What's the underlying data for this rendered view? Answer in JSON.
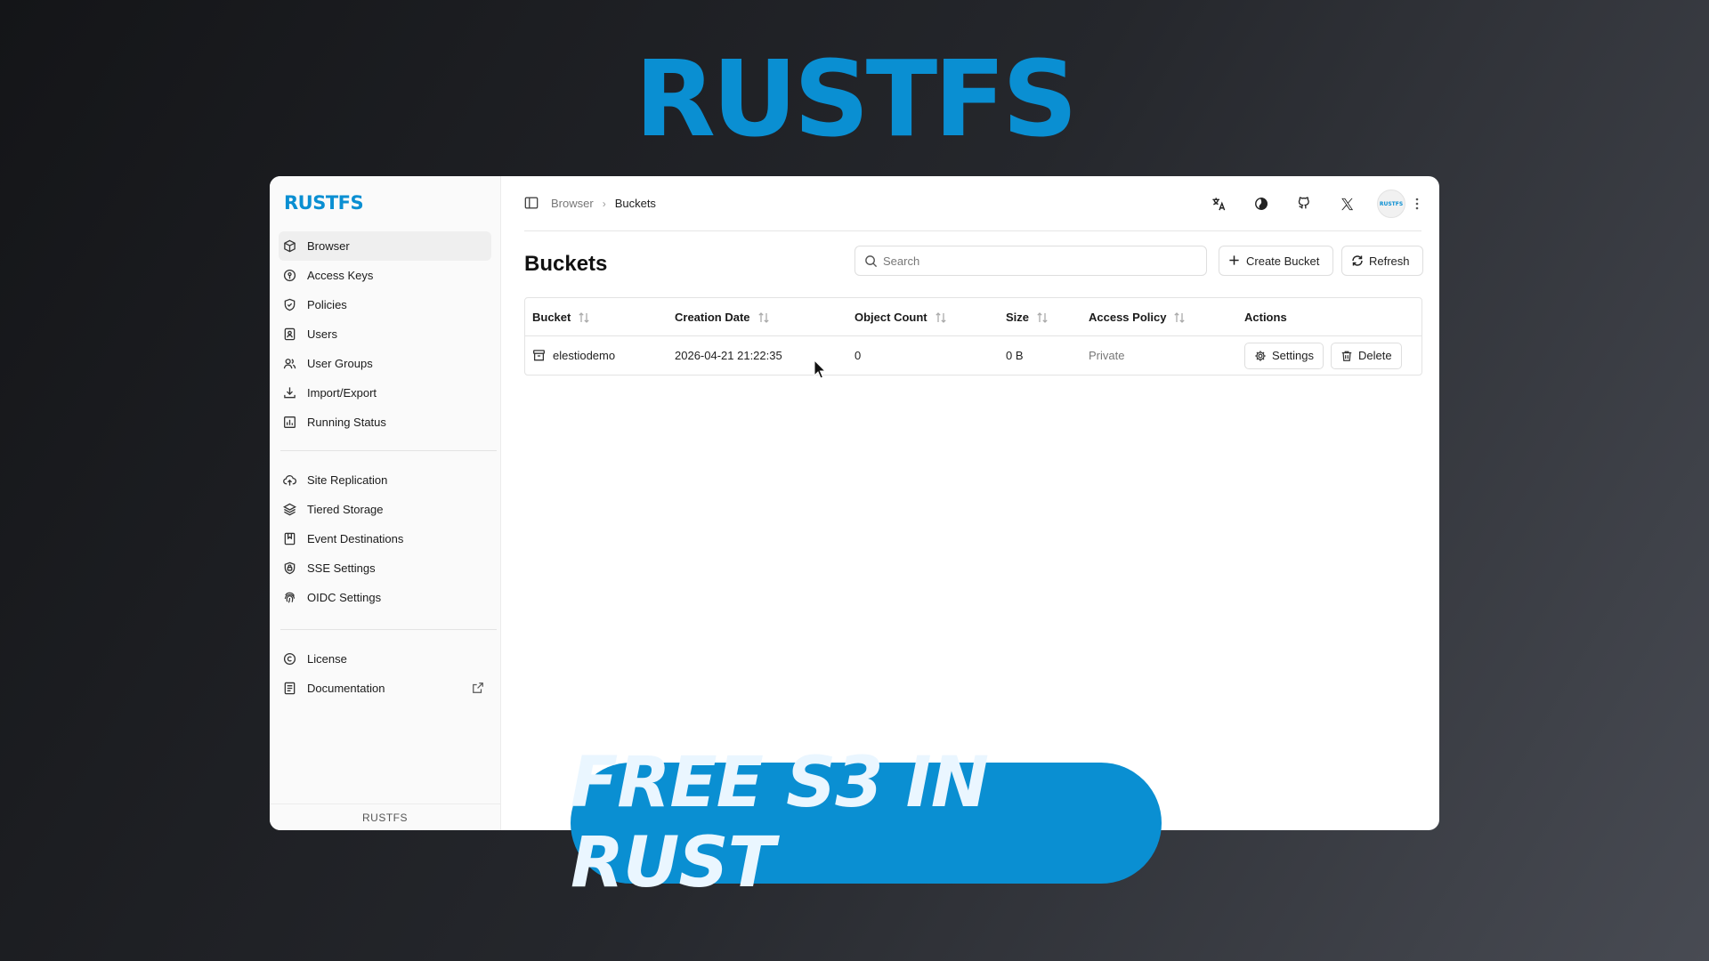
{
  "hero": {
    "logo_text": "RUSTFS"
  },
  "sidebar": {
    "logo_text": "RUSTFS",
    "group1": [
      {
        "label": "Browser",
        "icon": "cube-icon",
        "active": true
      },
      {
        "label": "Access Keys",
        "icon": "key-icon"
      },
      {
        "label": "Policies",
        "icon": "shield-icon"
      },
      {
        "label": "Users",
        "icon": "user-file-icon"
      },
      {
        "label": "User Groups",
        "icon": "users-icon"
      },
      {
        "label": "Import/Export",
        "icon": "download-icon"
      },
      {
        "label": "Running Status",
        "icon": "chart-icon"
      }
    ],
    "group2": [
      {
        "label": "Site Replication",
        "icon": "cloud-upload-icon"
      },
      {
        "label": "Tiered Storage",
        "icon": "layers-icon"
      },
      {
        "label": "Event Destinations",
        "icon": "bookmark-icon"
      },
      {
        "label": "SSE Settings",
        "icon": "lock-shield-icon"
      },
      {
        "label": "OIDC Settings",
        "icon": "fingerprint-icon"
      }
    ],
    "group3": [
      {
        "label": "License",
        "icon": "copyright-icon"
      },
      {
        "label": "Documentation",
        "icon": "document-icon",
        "external": true
      }
    ],
    "footer": "RUSTFS"
  },
  "topbar": {
    "breadcrumb": {
      "parent": "Browser",
      "current": "Buckets"
    },
    "icons": [
      "translate-icon",
      "theme-icon",
      "github-icon",
      "x-logo-icon"
    ],
    "avatar_text": "RUSTFS"
  },
  "page": {
    "title": "Buckets",
    "search_placeholder": "Search",
    "create_label": "Create Bucket",
    "refresh_label": "Refresh"
  },
  "table": {
    "columns": [
      "Bucket",
      "Creation Date",
      "Object Count",
      "Size",
      "Access Policy",
      "Actions"
    ],
    "rows": [
      {
        "bucket": "elestiodemo",
        "created": "2026-04-21 21:22:35",
        "objects": "0",
        "size": "0 B",
        "policy": "Private",
        "settings_label": "Settings",
        "delete_label": "Delete"
      }
    ]
  },
  "banner": {
    "text": "FREE S3 IN RUST"
  },
  "colors": {
    "brand": "#0a8fd2",
    "banner_text": "#eaf6ff"
  }
}
